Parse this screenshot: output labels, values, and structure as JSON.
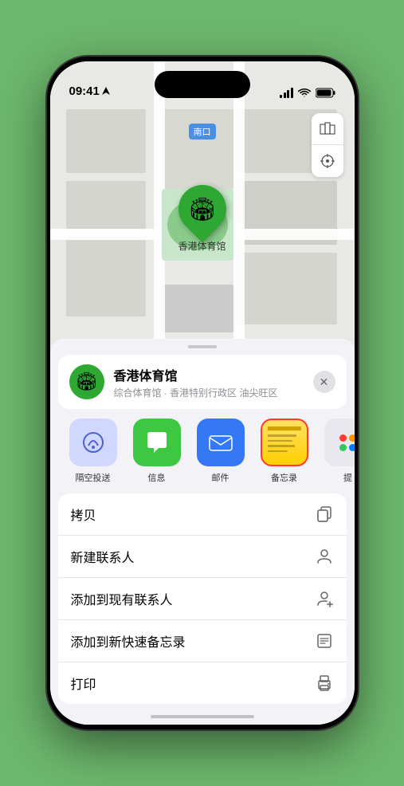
{
  "status_bar": {
    "time": "09:41",
    "location_arrow": "▶"
  },
  "map": {
    "label": "南口",
    "pin_label": "香港体育馆",
    "controls": {
      "map_icon": "🗺",
      "location_icon": "⊹"
    }
  },
  "venue": {
    "name": "香港体育馆",
    "subtitle": "综合体育馆 · 香港特别行政区 油尖旺区",
    "close_label": "✕"
  },
  "share_items": [
    {
      "id": "airdrop",
      "label": "隔空投送",
      "icon_type": "airdrop"
    },
    {
      "id": "messages",
      "label": "信息",
      "icon_type": "messages"
    },
    {
      "id": "mail",
      "label": "邮件",
      "icon_type": "mail"
    },
    {
      "id": "notes",
      "label": "备忘录",
      "icon_type": "notes"
    },
    {
      "id": "more",
      "label": "提",
      "icon_type": "more"
    }
  ],
  "action_items": [
    {
      "id": "copy",
      "label": "拷贝"
    },
    {
      "id": "new-contact",
      "label": "新建联系人"
    },
    {
      "id": "add-existing",
      "label": "添加到现有联系人"
    },
    {
      "id": "add-note",
      "label": "添加到新快速备忘录"
    },
    {
      "id": "print",
      "label": "打印"
    }
  ]
}
